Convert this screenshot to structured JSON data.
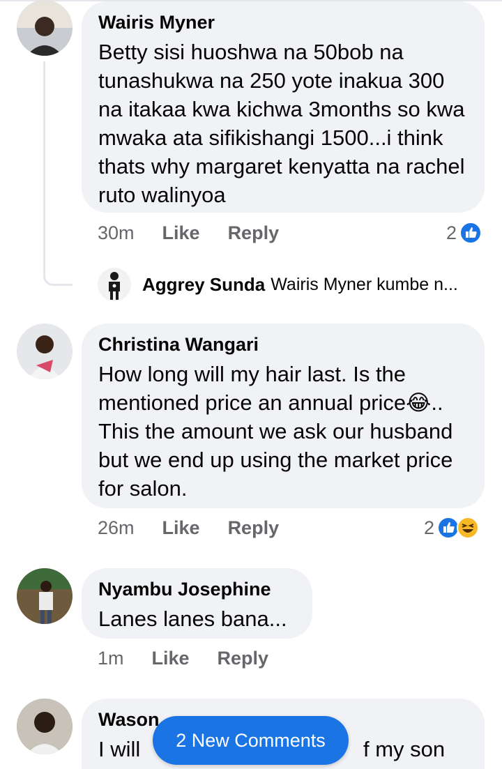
{
  "comments": [
    {
      "author": "Wairis Myner",
      "text": "Betty sisi huoshwa na 50bob na tunashukwa na 250 yote inakua 300 na itakaa kwa kichwa 3months so kwa mwaka ata sifikishangi 1500...i think thats why margaret kenyatta na rachel ruto walinyoa",
      "time": "30m",
      "like_label": "Like",
      "reply_label": "Reply",
      "reaction_count": "2",
      "reactions": [
        "like-icon"
      ]
    },
    {
      "author": "Christina Wangari",
      "text": "How long will my hair last. Is the mentioned price an annual price😂.. This the amount we ask our husband but we end up using the market price for salon.",
      "time": "26m",
      "like_label": "Like",
      "reply_label": "Reply",
      "reaction_count": "2",
      "reactions": [
        "like-icon",
        "haha-icon"
      ]
    },
    {
      "author": "Nyambu Josephine",
      "text": "Lanes lanes bana...",
      "time": "1m",
      "like_label": "Like",
      "reply_label": "Reply"
    },
    {
      "author": "Wason",
      "text_left": "I will",
      "text_right": "f my son"
    }
  ],
  "reply_preview": {
    "author": "Aggrey Sunda",
    "snippet": "Wairis Myner kumbe n..."
  },
  "new_comments_label": "2 New Comments",
  "colors": {
    "bubble": "#f0f2f5",
    "meta_text": "#65676b",
    "accent_blue": "#1b74e4",
    "haha_yellow": "#f7b928"
  }
}
